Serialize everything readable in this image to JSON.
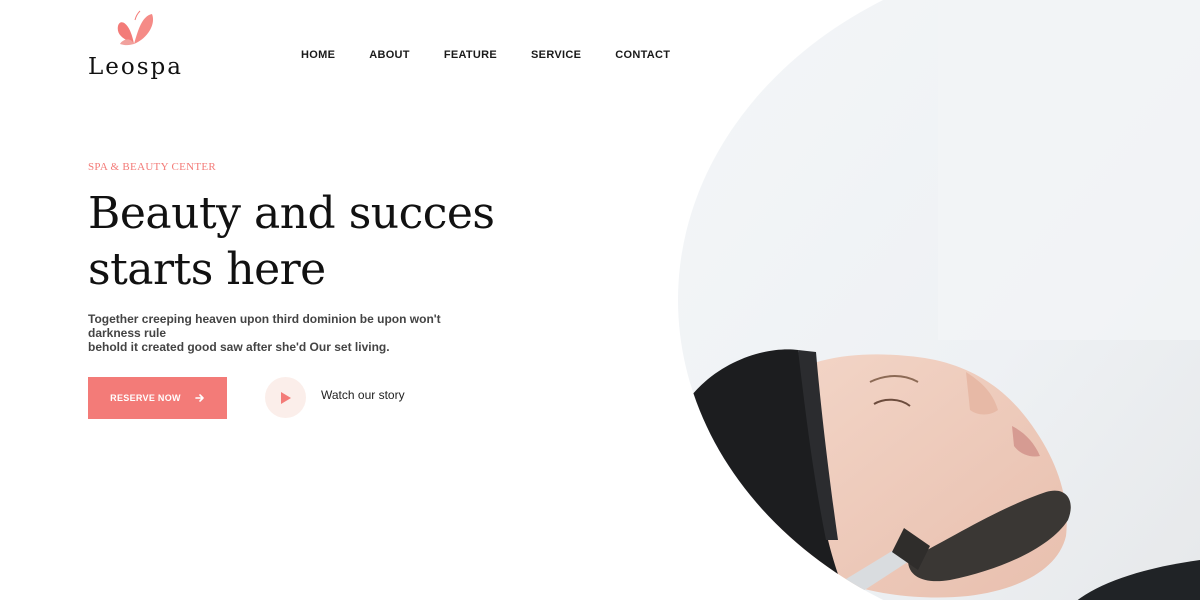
{
  "brand": {
    "name": "Leospa",
    "accent_color": "#f37b78",
    "logo_icon": "butterfly-icon"
  },
  "nav": {
    "items": [
      {
        "label": "HOME"
      },
      {
        "label": "ABOUT"
      },
      {
        "label": "FEATURE"
      },
      {
        "label": "SERVICE"
      },
      {
        "label": "CONTACT"
      }
    ]
  },
  "hero": {
    "eyebrow": "SPA & BEAUTY CENTER",
    "headline_line1": "Beauty and succes",
    "headline_line2": "starts here",
    "description_line1": "Together creeping heaven upon third dominion be upon won't darkness rule",
    "description_line2": "behold it created good saw after she'd Our set living.",
    "cta_label": "RESERVE NOW",
    "cta_icon": "arrow-right-icon",
    "play_icon": "play-icon",
    "watch_label": "Watch our story",
    "image_subject": "woman-facial-treatment-photo"
  }
}
